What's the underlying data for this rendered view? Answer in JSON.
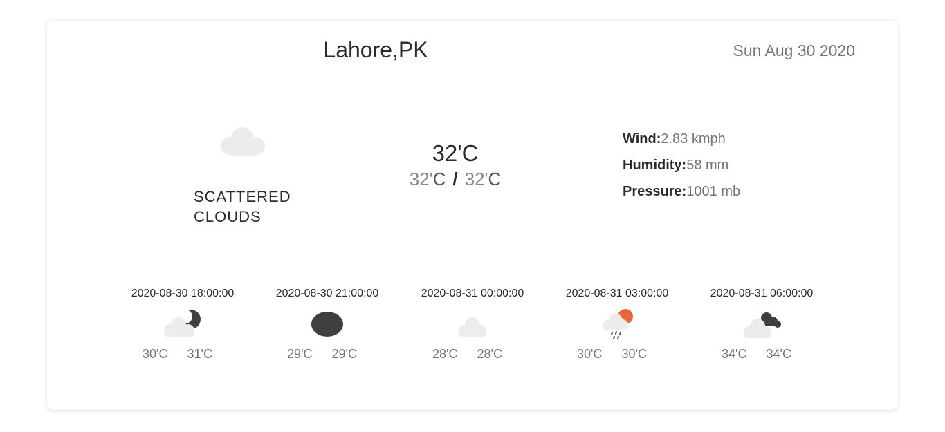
{
  "header": {
    "city": "Lahore,PK",
    "date": "Sun Aug 30 2020"
  },
  "current": {
    "icon": "cloud-icon",
    "description": "Scattered Clouds",
    "temp": "32'C",
    "temp_min_num": "32'",
    "temp_min_unit": "C",
    "separator": "/",
    "temp_max_num": "32'",
    "temp_max_unit": "C",
    "wind_label": "Wind:",
    "wind_value": "2.83 kmph",
    "humidity_label": "Humidity:",
    "humidity_value": "58 mm",
    "pressure_label": "Pressure:",
    "pressure_value": "1001 mb"
  },
  "forecast": [
    {
      "time": "2020-08-30 18:00:00",
      "icon": "cloud-moon-icon",
      "min": "30'C",
      "max": "31'C"
    },
    {
      "time": "2020-08-30 21:00:00",
      "icon": "moon-icon",
      "min": "29'C",
      "max": "29'C"
    },
    {
      "time": "2020-08-31 00:00:00",
      "icon": "cloud-icon",
      "min": "28'C",
      "max": "28'C"
    },
    {
      "time": "2020-08-31 03:00:00",
      "icon": "rain-sun-icon",
      "min": "30'C",
      "max": "30'C"
    },
    {
      "time": "2020-08-31 06:00:00",
      "icon": "broken-clouds-icon",
      "min": "34'C",
      "max": "34'C"
    }
  ],
  "colors": {
    "cloud": "#ececec",
    "dark": "#3f3f3f",
    "sun": "#e8643a",
    "rain": "#555555",
    "muted_text": "#757575"
  }
}
